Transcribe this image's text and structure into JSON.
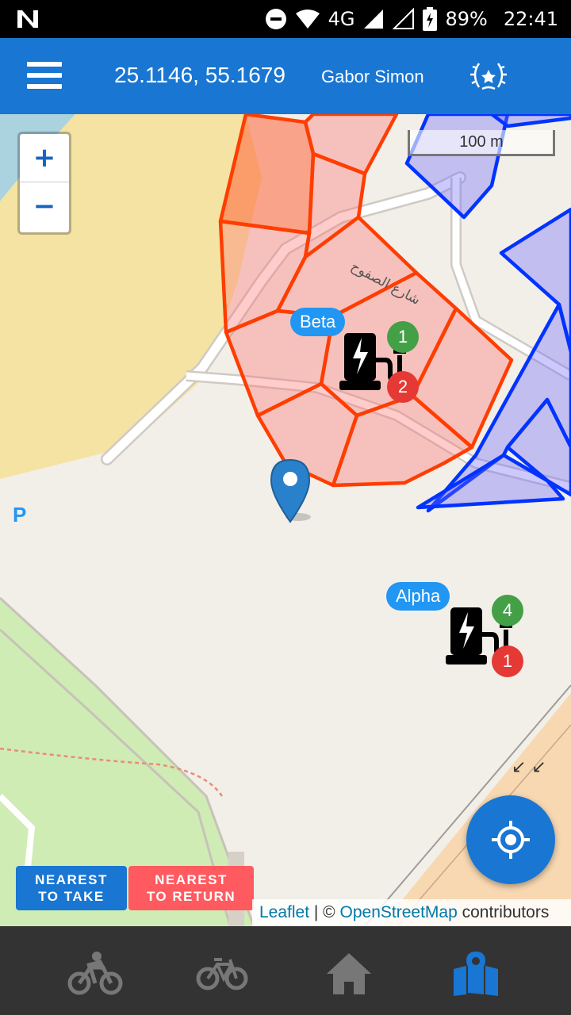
{
  "status_bar": {
    "network": "4G",
    "battery": "89%",
    "time": "22:41"
  },
  "app_bar": {
    "coordinates": "25.1146, 55.1679",
    "user_name": "Gabor Simon"
  },
  "map": {
    "zoom_in": "+",
    "zoom_out": "−",
    "scale": "100 m",
    "parking_label": "P",
    "stations": [
      {
        "name": "Beta",
        "available_bikes": "1",
        "free_slots": "2"
      },
      {
        "name": "Alpha",
        "available_bikes": "4",
        "free_slots": "1"
      }
    ],
    "attribution": {
      "leaflet": "Leaflet",
      "separator": " | © ",
      "osm": "OpenStreetMap",
      "suffix": " contributors"
    }
  },
  "buttons": {
    "nearest_take_line1": "NEAREST",
    "nearest_take_line2": "TO TAKE",
    "nearest_return_line1": "NEAREST",
    "nearest_return_line2": "TO RETURN"
  },
  "bottom_nav": [
    {
      "icon": "cyclist-icon"
    },
    {
      "icon": "bicycle-icon"
    },
    {
      "icon": "home-icon"
    },
    {
      "icon": "map-marker-icon",
      "active": true
    }
  ],
  "colors": {
    "primary": "#1976d2",
    "return_button": "#ff5a5f",
    "zone_red": "#ff3d00",
    "zone_blue": "#0033ff",
    "badge_green": "#43a047",
    "badge_red": "#e53935",
    "station_label": "#2196f3"
  }
}
